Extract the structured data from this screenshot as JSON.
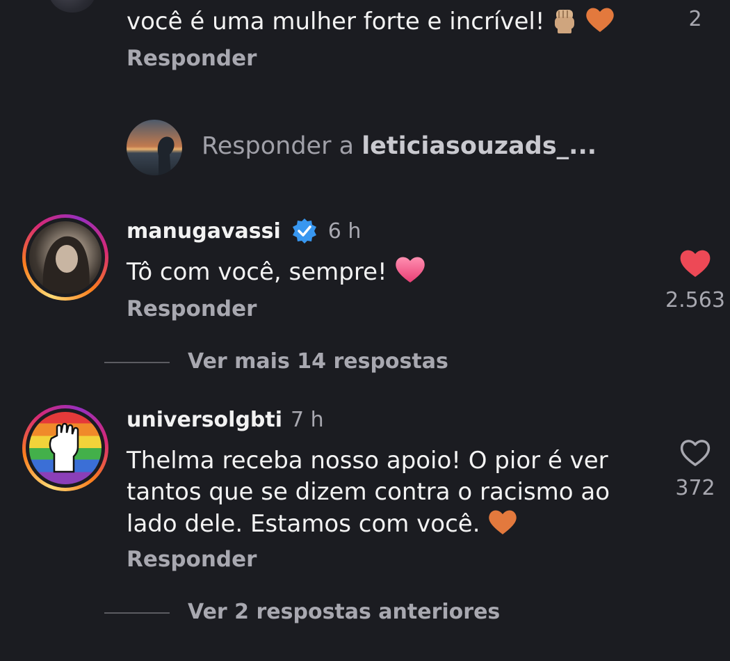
{
  "comments": [
    {
      "text": "você é uma mulher forte e incrível!",
      "emojis": [
        "raised-fist-emoji",
        "orange-heart-emoji"
      ],
      "like_count": "2",
      "reply_label": "Responder"
    },
    {
      "username": "manugavassi",
      "verified": true,
      "time": "6 h",
      "text": "Tô com você, sempre!",
      "emojis": [
        "pink-heart-emoji"
      ],
      "liked": true,
      "like_count": "2.563",
      "reply_label": "Responder",
      "view_more_label": "Ver mais 14 respostas"
    },
    {
      "username": "universolgbti",
      "verified": false,
      "time": "7 h",
      "text_lines": [
        "Thelma receba nosso apoio! O pior é ver",
        "tantos que se dizem contra o racismo ao",
        "lado dele. Estamos com você."
      ],
      "emojis": [
        "orange-heart-emoji"
      ],
      "liked": false,
      "like_count": "372",
      "reply_label": "Responder",
      "view_more_label": "Ver 2 respostas anteriores"
    }
  ],
  "reply_input": {
    "prefix": "Responder a",
    "target": "leticiasouzads_..."
  },
  "colors": {
    "background": "#1b1c21",
    "like_red": "#ed4956",
    "verified_blue": "#3897f0",
    "secondary_text": "#a8a8b0"
  }
}
